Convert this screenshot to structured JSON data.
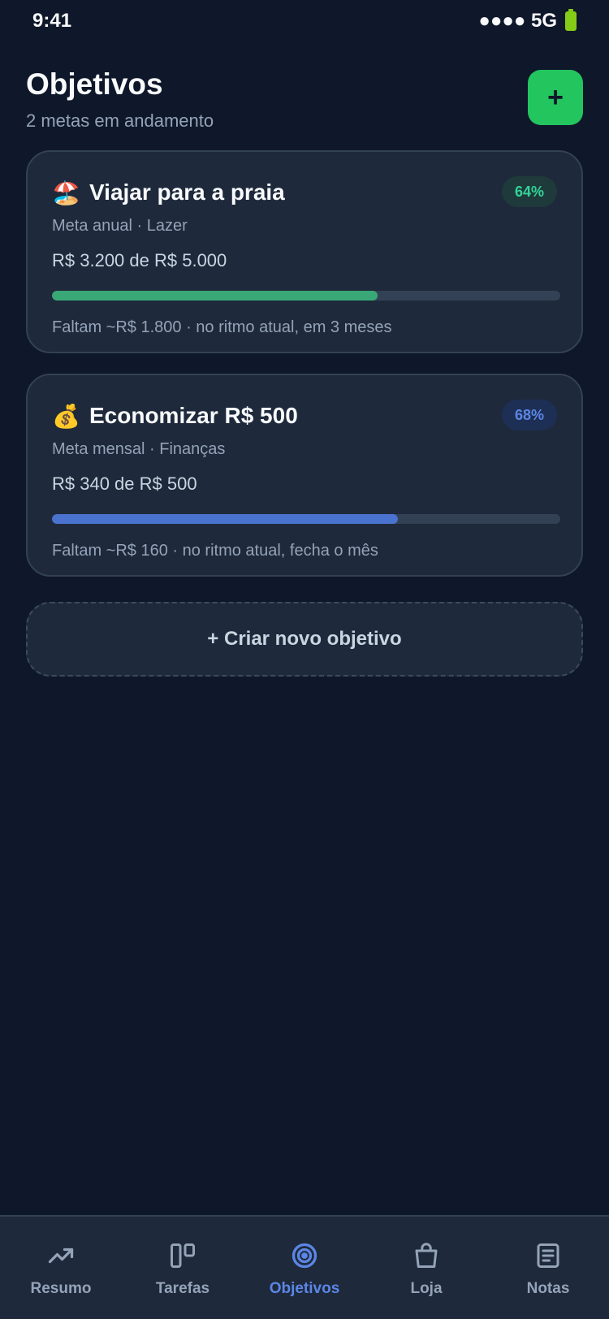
{
  "status": {
    "time": "9:41",
    "signal": "●●●● 5G"
  },
  "header": {
    "title": "Objetivos",
    "subtitle": "2 metas em andamento",
    "add_label": "+"
  },
  "goals": [
    {
      "emoji": "🏖️",
      "title": "Viajar para a praia",
      "meta": "Meta anual · Lazer",
      "amount": "R$ 3.200 de R$ 5.000",
      "percent_label": "64%",
      "progress": 0.64,
      "note": "Faltam ~R$ 1.800 · no ritmo atual, em 3 meses",
      "color": "#3aa876"
    },
    {
      "emoji": "💰",
      "title": "Economizar R$ 500",
      "meta": "Meta mensal · Finanças",
      "amount": "R$ 340 de R$ 500",
      "percent_label": "68%",
      "progress": 0.68,
      "note": "Faltam ~R$ 160 · no ritmo atual, fecha o mês",
      "color": "#4a72cf"
    }
  ],
  "create_label": "+ Criar novo objetivo",
  "nav": [
    {
      "label": "Resumo",
      "icon": "trending-up-icon",
      "active": false
    },
    {
      "label": "Tarefas",
      "icon": "board-icon",
      "active": false
    },
    {
      "label": "Objetivos",
      "icon": "target-icon",
      "active": true
    },
    {
      "label": "Loja",
      "icon": "shopping-bag-icon",
      "active": false
    },
    {
      "label": "Notas",
      "icon": "notes-icon",
      "active": false
    }
  ]
}
